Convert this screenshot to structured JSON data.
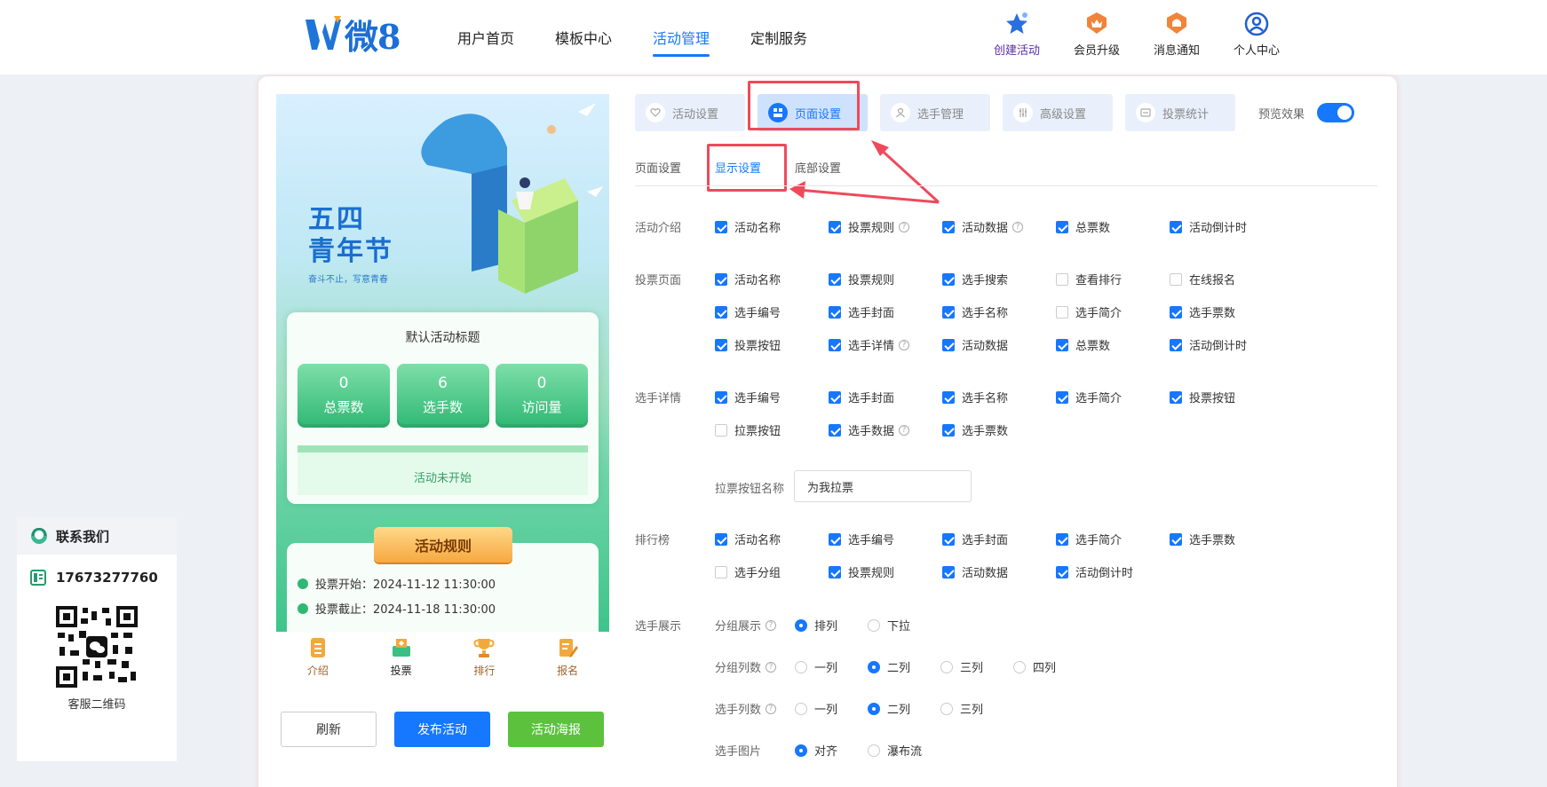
{
  "brand": {
    "logo_text": "微8"
  },
  "nav": {
    "items": [
      "用户首页",
      "模板中心",
      "活动管理",
      "定制服务"
    ]
  },
  "tools": [
    "创建活动",
    "会员升级",
    "消息通知",
    "个人中心"
  ],
  "contact": {
    "title": "联系我们",
    "phone": "17673277760",
    "qr_caption": "客服二维码"
  },
  "preview": {
    "hero_title_1": "五四",
    "hero_title_2": "青年节",
    "hero_sub": "奋斗不止，写意青春",
    "card_title": "默认活动标题",
    "stats": [
      {
        "value": "0",
        "label": "总票数"
      },
      {
        "value": "6",
        "label": "选手数"
      },
      {
        "value": "0",
        "label": "访问量"
      }
    ],
    "status": "活动未开始",
    "rules_title": "活动规则",
    "vote_start": "投票开始：2024-11-12 11:30:00",
    "vote_end": "投票截止：2024-11-18 11:30:00",
    "tabs": [
      "介绍",
      "投票",
      "排行",
      "报名"
    ]
  },
  "buttons": {
    "refresh": "刷新",
    "publish": "发布活动",
    "poster": "活动海报"
  },
  "steps": [
    "活动设置",
    "页面设置",
    "选手管理",
    "高级设置",
    "投票统计"
  ],
  "preview_toggle": "预览效果",
  "subtabs": [
    "页面设置",
    "显示设置",
    "底部设置"
  ],
  "sections": {
    "intro": {
      "label": "活动介绍",
      "items": [
        {
          "text": "活动名称",
          "checked": true
        },
        {
          "text": "投票规则",
          "checked": true
        },
        {
          "text": "活动数据",
          "checked": true
        },
        {
          "text": "总票数",
          "checked": true
        },
        {
          "text": "活动倒计时",
          "checked": true
        }
      ]
    },
    "vote_page": {
      "label": "投票页面",
      "items": [
        {
          "text": "活动名称",
          "checked": true
        },
        {
          "text": "投票规则",
          "checked": true
        },
        {
          "text": "选手搜索",
          "checked": true
        },
        {
          "text": "查看排行",
          "checked": false
        },
        {
          "text": "在线报名",
          "checked": false
        },
        {
          "text": "选手编号",
          "checked": true
        },
        {
          "text": "选手封面",
          "checked": true
        },
        {
          "text": "选手名称",
          "checked": true
        },
        {
          "text": "选手简介",
          "checked": false
        },
        {
          "text": "选手票数",
          "checked": true
        },
        {
          "text": "投票按钮",
          "checked": true
        },
        {
          "text": "选手详情",
          "checked": true
        },
        {
          "text": "活动数据",
          "checked": true
        },
        {
          "text": "总票数",
          "checked": true
        },
        {
          "text": "活动倒计时",
          "checked": true
        }
      ]
    },
    "detail": {
      "label": "选手详情",
      "items": [
        {
          "text": "选手编号",
          "checked": true
        },
        {
          "text": "选手封面",
          "checked": true
        },
        {
          "text": "选手名称",
          "checked": true
        },
        {
          "text": "选手简介",
          "checked": true
        },
        {
          "text": "投票按钮",
          "checked": true
        },
        {
          "text": "拉票按钮",
          "checked": false
        },
        {
          "text": "选手数据",
          "checked": true
        },
        {
          "text": "选手票数",
          "checked": true
        }
      ],
      "canvass_label": "拉票按钮名称",
      "canvass_value": "为我拉票"
    },
    "ranking": {
      "label": "排行榜",
      "items": [
        {
          "text": "活动名称",
          "checked": true
        },
        {
          "text": "选手编号",
          "checked": true
        },
        {
          "text": "选手封面",
          "checked": true
        },
        {
          "text": "选手简介",
          "checked": true
        },
        {
          "text": "选手票数",
          "checked": true
        },
        {
          "text": "选手分组",
          "checked": false
        },
        {
          "text": "投票规则",
          "checked": true
        },
        {
          "text": "活动数据",
          "checked": true
        },
        {
          "text": "活动倒计时",
          "checked": true
        }
      ]
    },
    "display": {
      "label": "选手展示",
      "group_display": {
        "label": "分组展示",
        "options": [
          "排列",
          "下拉"
        ],
        "selected": "排列"
      },
      "group_cols": {
        "label": "分组列数",
        "options": [
          "一列",
          "二列",
          "三列",
          "四列"
        ],
        "selected": "二列"
      },
      "player_cols": {
        "label": "选手列数",
        "options": [
          "一列",
          "二列",
          "三列"
        ],
        "selected": "二列"
      },
      "player_image": {
        "label": "选手图片",
        "options": [
          "对齐",
          "瀑布流"
        ],
        "selected": "对齐"
      }
    }
  },
  "colors": {
    "primary": "#1677ff",
    "highlight": "#ee4a5c",
    "poster": "#5cc23e"
  }
}
